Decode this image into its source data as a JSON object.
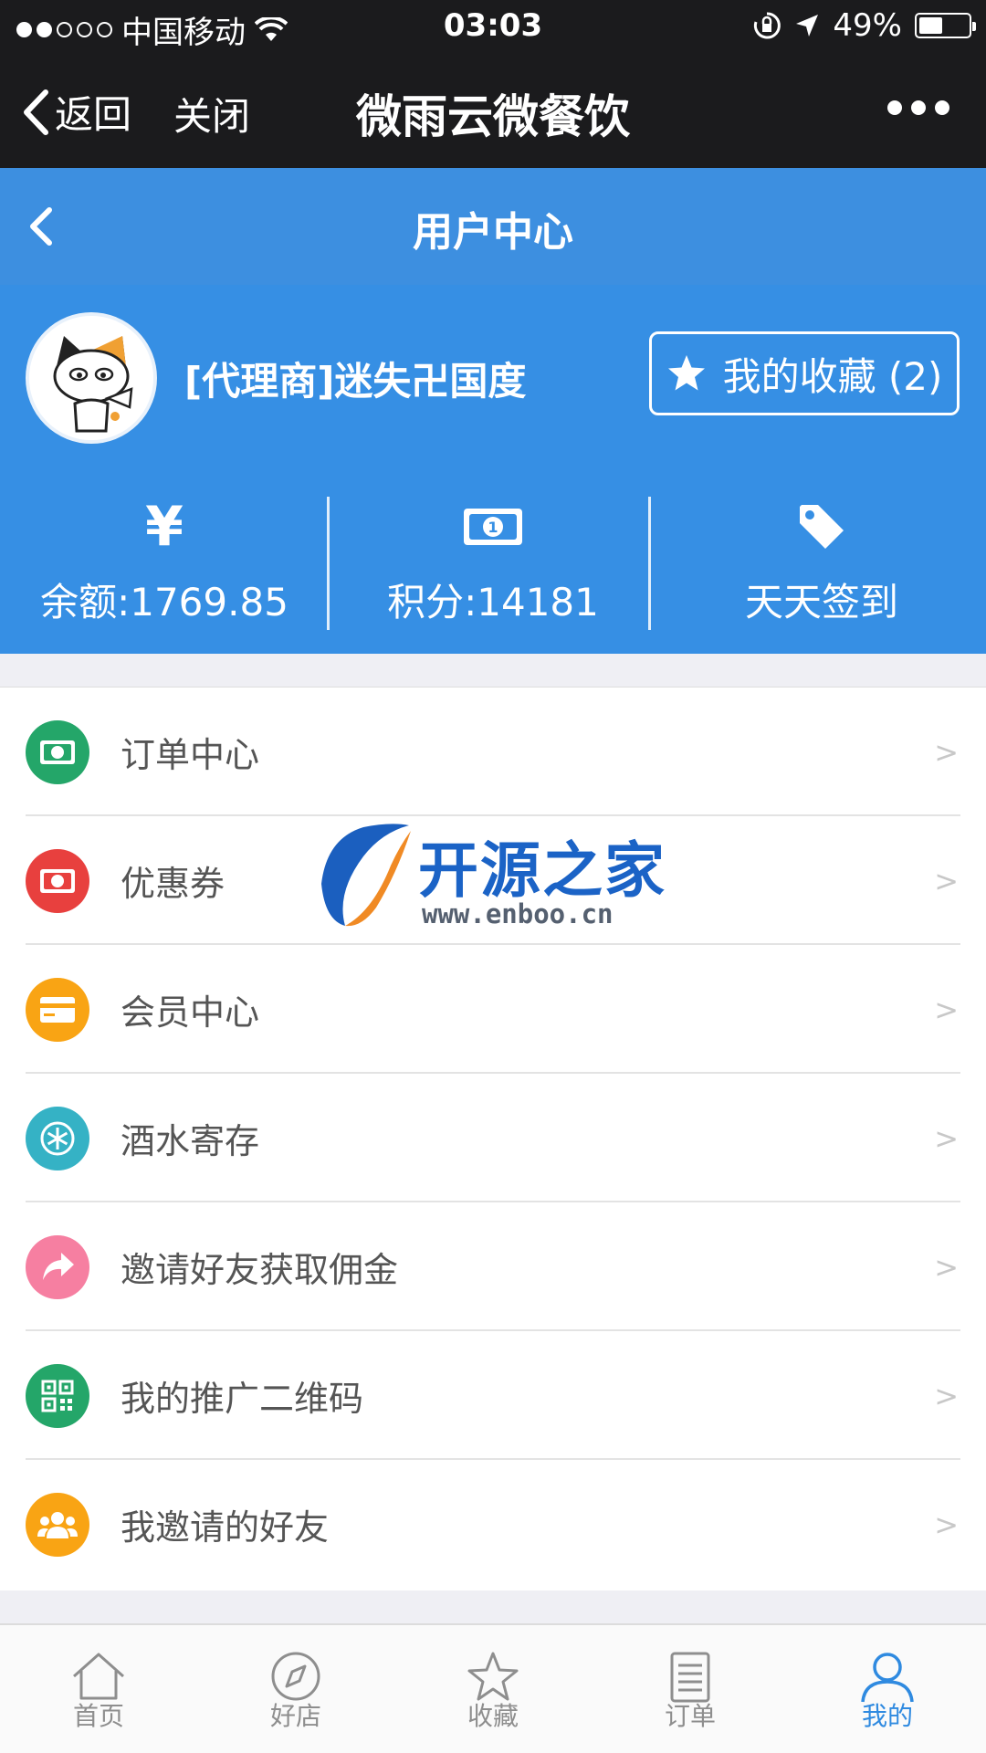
{
  "status_bar": {
    "carrier": "中国移动",
    "time": "03:03",
    "battery": "49%",
    "battery_level": 0.49
  },
  "wechat_nav": {
    "back_label": "返回",
    "close_label": "关闭",
    "title": "微雨云微餐饮"
  },
  "page_header": {
    "title": "用户中心"
  },
  "profile": {
    "username": "[代理商]迷失卍国度",
    "favorites_label": "我的收藏 (2)"
  },
  "stats": [
    {
      "icon": "yen-icon",
      "symbol": "¥",
      "label": "余额:1769.85"
    },
    {
      "icon": "banknote-icon",
      "label": "积分:14181"
    },
    {
      "icon": "tag-icon",
      "label": "天天签到"
    }
  ],
  "menu": [
    {
      "label": "订单中心",
      "icon": "banknote-icon",
      "color": "#24a669",
      "arrow": ">"
    },
    {
      "label": "优惠券",
      "icon": "banknote-icon",
      "color": "#e8403e",
      "arrow": ">"
    },
    {
      "label": "会员中心",
      "icon": "card-icon",
      "color": "#f9a414",
      "arrow": ">"
    },
    {
      "label": "酒水寄存",
      "icon": "snowflake-icon",
      "color": "#35b2c5",
      "arrow": ">"
    },
    {
      "label": "邀请好友获取佣金",
      "icon": "share-icon",
      "color": "#f67fa1",
      "arrow": ">"
    },
    {
      "label": "我的推广二维码",
      "icon": "qrcode-icon",
      "color": "#24a669",
      "arrow": ">"
    },
    {
      "label": "我邀请的好友",
      "icon": "users-icon",
      "color": "#f9a414",
      "arrow": ">"
    }
  ],
  "watermark": {
    "text": "开源之家",
    "url": "www.enboo.cn"
  },
  "tabbar": [
    {
      "label": "首页",
      "icon": "home-icon",
      "active": false
    },
    {
      "label": "好店",
      "icon": "compass-icon",
      "active": false
    },
    {
      "label": "收藏",
      "icon": "star-icon",
      "active": false
    },
    {
      "label": "订单",
      "icon": "document-icon",
      "active": false
    },
    {
      "label": "我的",
      "icon": "user-icon",
      "active": true
    }
  ],
  "colors": {
    "header_blue": "#3d8fe0",
    "profile_blue": "#368fe4",
    "active_tab": "#2f8ae0"
  }
}
